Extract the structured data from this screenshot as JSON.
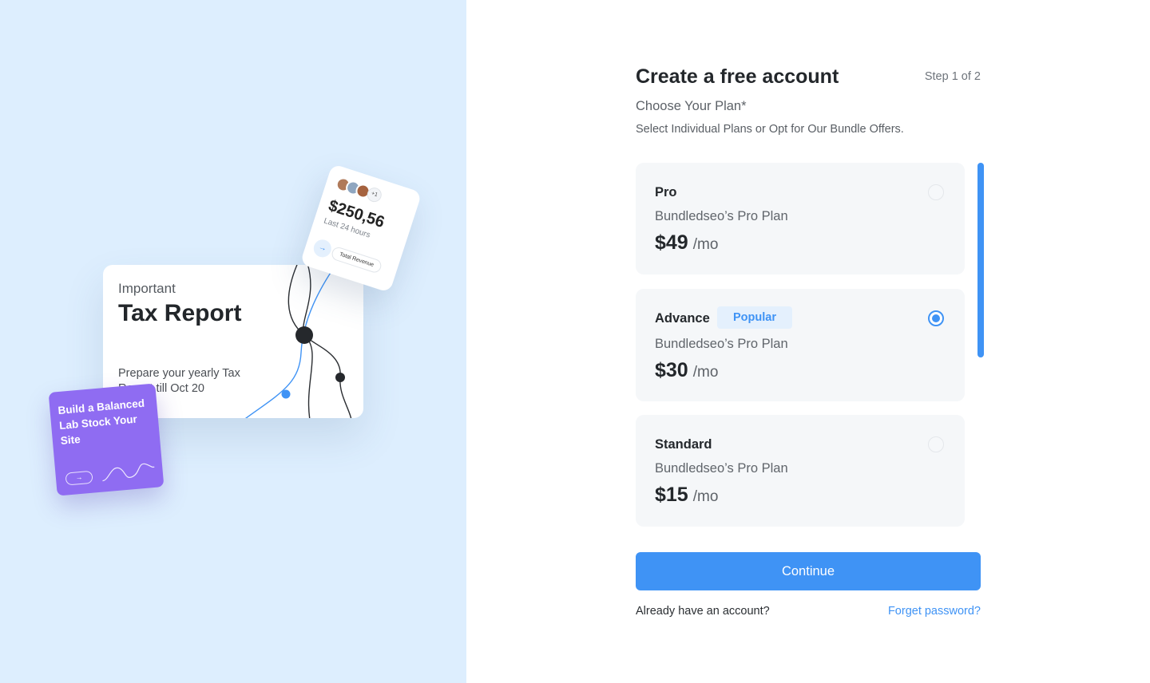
{
  "illustration": {
    "tax_card": {
      "kicker": "Important",
      "title": "Tax Report",
      "description": "Prepare your yearly Tax Report till Oct 20"
    },
    "revenue_card": {
      "amount": "$250,56",
      "period": "Last 24 hours",
      "avatar_more": "+1",
      "pill_label": "Total Revenue"
    },
    "lab_card": {
      "text": "Build a Balanced Lab Stock Your Site"
    }
  },
  "form": {
    "title": "Create a free account",
    "step": "Step 1 of 2",
    "subtitle": "Choose Your Plan*",
    "hint": "Select Individual Plans or Opt for Our Bundle Offers.",
    "plans": [
      {
        "name": "Pro",
        "description": "Bundledseo’s Pro Plan",
        "price": "$49",
        "unit": "/mo",
        "selected": false
      },
      {
        "name": "Advance",
        "badge": "Popular",
        "description": "Bundledseo’s Pro Plan",
        "price": "$30",
        "unit": "/mo",
        "selected": true
      },
      {
        "name": "Standard",
        "description": "Bundledseo’s Pro Plan",
        "price": "$15",
        "unit": "/mo",
        "selected": false
      }
    ],
    "continue_label": "Continue",
    "have_account_text": "Already have an account?",
    "forget_password_label": "Forget password?"
  },
  "colors": {
    "accent": "#3f93f5",
    "left_background": "#ddeefe",
    "lab_card": "#8f6cf2",
    "card_background": "#f5f7f9"
  }
}
